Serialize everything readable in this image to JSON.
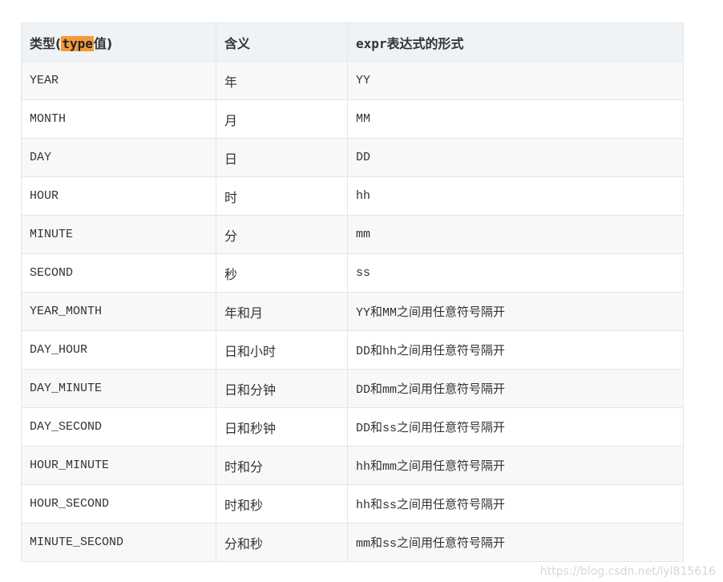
{
  "header": {
    "col1_prefix": "类型(",
    "col1_highlight": "type",
    "col1_suffix": "值)",
    "col2": "含义",
    "col3": "expr表达式的形式"
  },
  "rows": [
    {
      "type": "YEAR",
      "meaning": "年",
      "expr": "YY"
    },
    {
      "type": "MONTH",
      "meaning": "月",
      "expr": "MM"
    },
    {
      "type": "DAY",
      "meaning": "日",
      "expr": "DD"
    },
    {
      "type": "HOUR",
      "meaning": "时",
      "expr": "hh"
    },
    {
      "type": "MINUTE",
      "meaning": "分",
      "expr": "mm"
    },
    {
      "type": "SECOND",
      "meaning": "秒",
      "expr": "ss"
    },
    {
      "type": "YEAR_MONTH",
      "meaning": "年和月",
      "expr": "YY和MM之间用任意符号隔开"
    },
    {
      "type": "DAY_HOUR",
      "meaning": "日和小时",
      "expr": "DD和hh之间用任意符号隔开"
    },
    {
      "type": "DAY_MINUTE",
      "meaning": "日和分钟",
      "expr": "DD和mm之间用任意符号隔开"
    },
    {
      "type": "DAY_SECOND",
      "meaning": "日和秒钟",
      "expr": "DD和ss之间用任意符号隔开"
    },
    {
      "type": "HOUR_MINUTE",
      "meaning": "时和分",
      "expr": "hh和mm之间用任意符号隔开"
    },
    {
      "type": "HOUR_SECOND",
      "meaning": "时和秒",
      "expr": "hh和ss之间用任意符号隔开"
    },
    {
      "type": "MINUTE_SECOND",
      "meaning": "分和秒",
      "expr": "mm和ss之间用任意符号隔开"
    }
  ],
  "watermark": "https://blog.csdn.net/lyl815616",
  "colors": {
    "header_bg": "#eff3f5",
    "highlight": "#f59a3a",
    "border": "#e3e6ea"
  }
}
